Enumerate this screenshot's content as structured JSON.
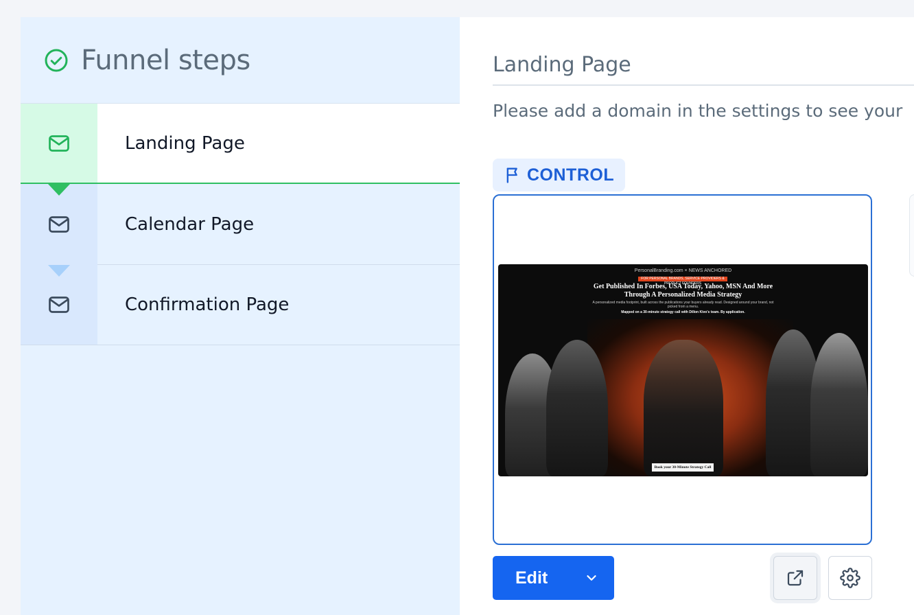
{
  "sidebar": {
    "title": "Funnel steps",
    "steps": [
      {
        "label": "Landing Page",
        "state": "active"
      },
      {
        "label": "Calendar Page",
        "state": "inactive"
      },
      {
        "label": "Confirmation Page",
        "state": "inactive"
      }
    ]
  },
  "main": {
    "page_title": "Landing Page",
    "notice": "Please add a domain in the settings to see your",
    "variant_badge": "CONTROL",
    "preview": {
      "brand_line": "PersonalBranding.com  ×  NEWS ANCHORED",
      "ribbon": "FOR PERSONAL BRANDS, SERVICE PROVIDERS & PRODUCT FOUNDERS",
      "headline": "Get Published In Forbes, USA Today, Yahoo, MSN And More Through A Personalized Media Strategy",
      "subline": "A personalized media footprint, built across the publications your buyers already read. Designed around your brand, not picked from a menu.",
      "subline2": "Mapped on a 30-minute strategy call with Dillon Kivo's team. By application.",
      "cta": "Book your 30-Minute Strategy Call"
    },
    "edit_label": "Edit"
  },
  "colors": {
    "accent_blue": "#1565f0",
    "active_green": "#2fbf62",
    "sidebar_bg": "#e6f2ff"
  },
  "icons": {
    "header": "check-circle-icon",
    "step": "mail-icon",
    "badge": "flag-icon",
    "open": "external-link-icon",
    "settings": "gear-icon",
    "edit_menu": "chevron-down-icon"
  }
}
